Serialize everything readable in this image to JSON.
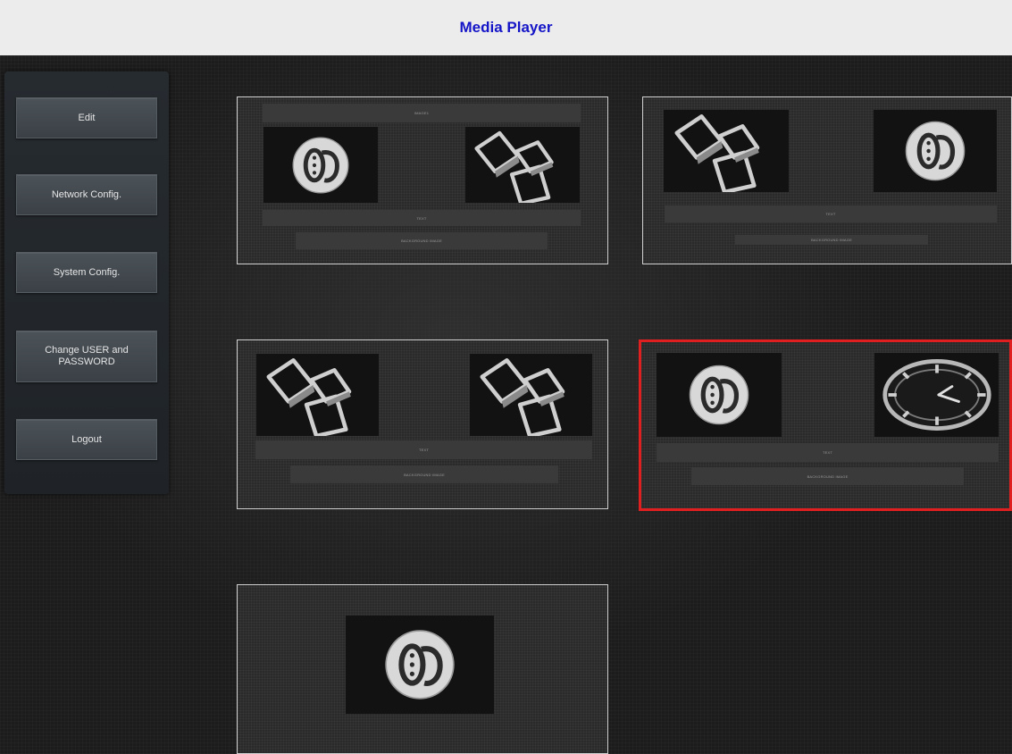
{
  "header": {
    "title": "Media Player"
  },
  "sidebar": {
    "items": [
      {
        "label": "Edit"
      },
      {
        "label": "Network Config."
      },
      {
        "label": "System Config."
      },
      {
        "label": "Change USER and PASSWORD"
      },
      {
        "label": "Logout"
      }
    ]
  },
  "layouts": [
    {
      "top_label": "IMAGE1",
      "text_label": "TEXT",
      "background_label": "BACKGROUND IMAGE",
      "thumbs": [
        "video-icon",
        "photos-icon"
      ],
      "selected": false
    },
    {
      "text_label": "TEXT",
      "background_label": "BACKGROUND IMAGE",
      "thumbs": [
        "photos-icon",
        "video-icon"
      ],
      "selected": false
    },
    {
      "text_label": "TEXT",
      "background_label": "BACKGROUND IMAGE",
      "thumbs": [
        "photos-icon",
        "photos-icon"
      ],
      "selected": false
    },
    {
      "text_label": "TEXT",
      "background_label": "BACKGROUND IMAGE",
      "thumbs": [
        "video-icon",
        "clock-icon"
      ],
      "selected": true
    },
    {
      "thumbs": [
        "video-icon"
      ],
      "selected": false
    }
  ],
  "colors": {
    "header_title": "#1515c8",
    "selection_border": "#e02020"
  }
}
